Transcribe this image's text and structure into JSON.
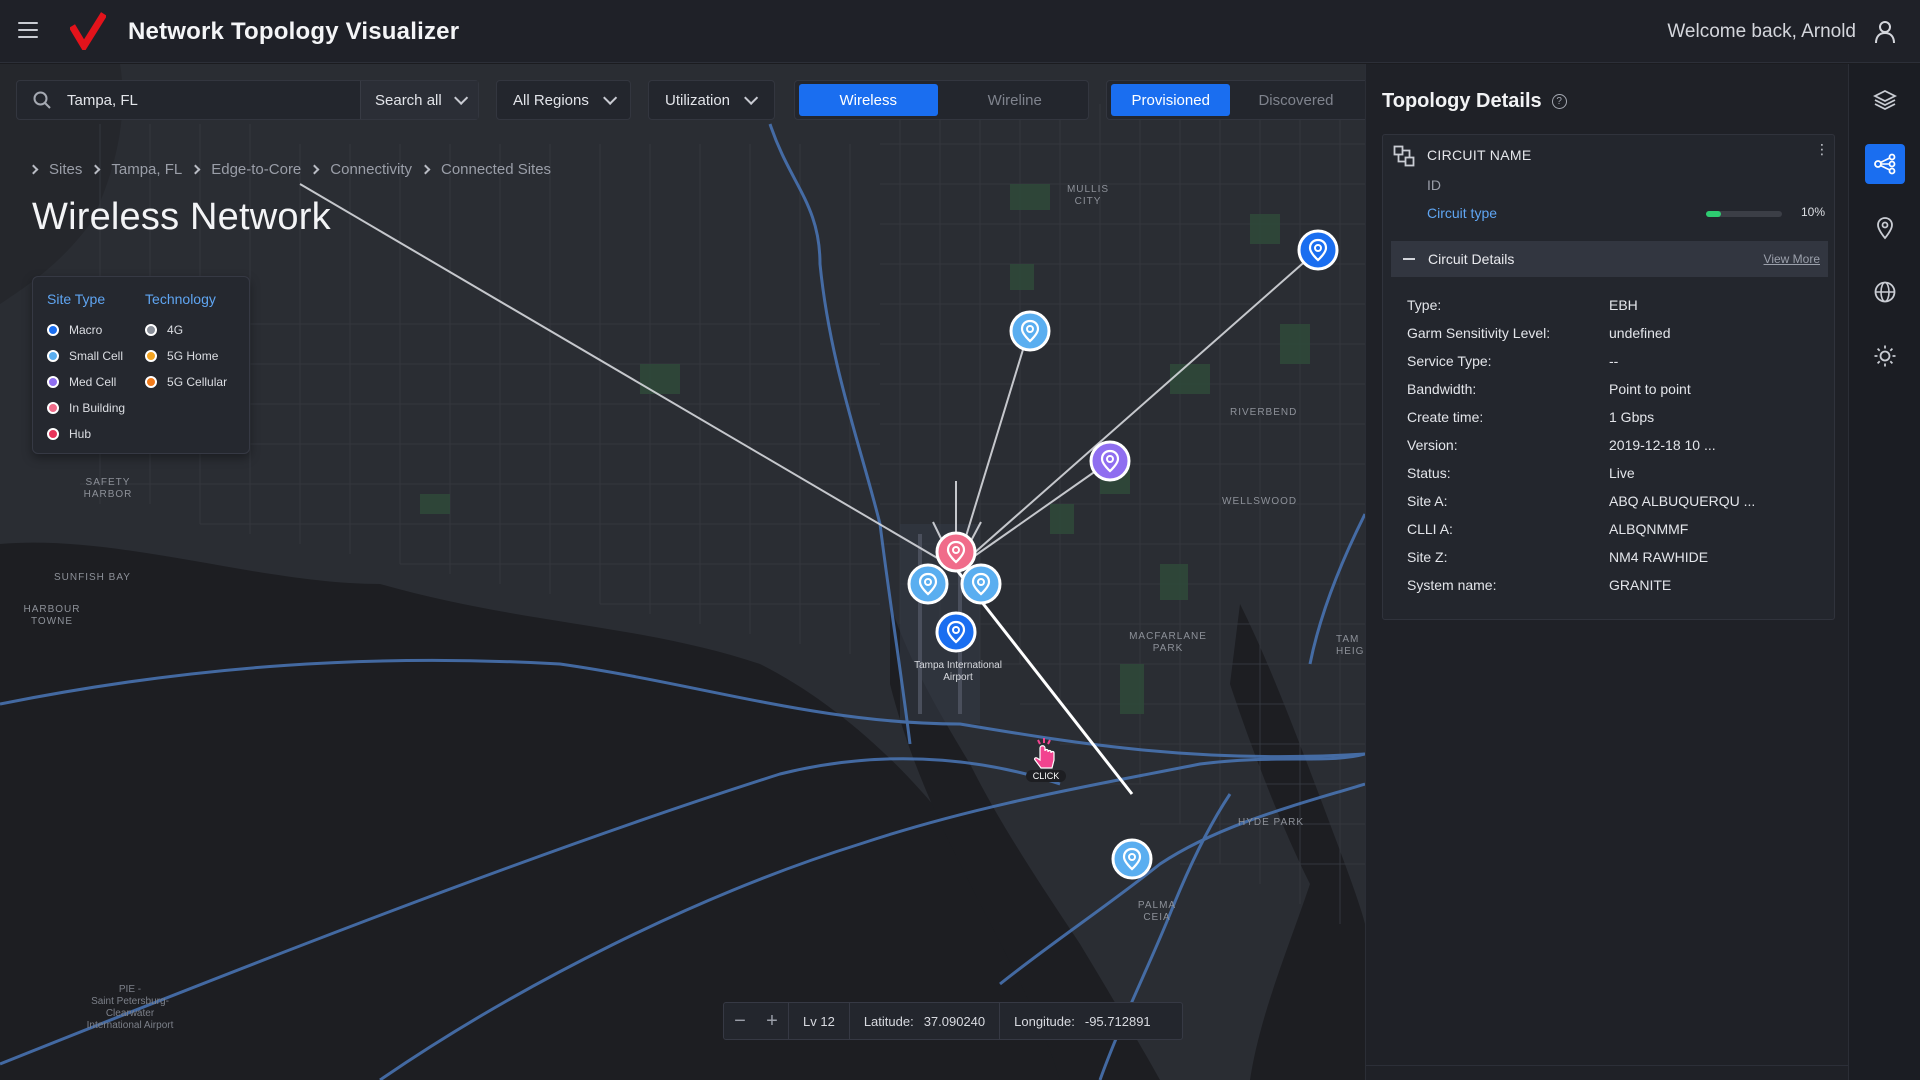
{
  "header": {
    "app_title": "Network Topology Visualizer",
    "welcome": "Welcome back, Arnold"
  },
  "search": {
    "value": "Tampa, FL",
    "scope": "Search all"
  },
  "filters": {
    "regions": "All Regions",
    "metric": "Utilization",
    "network_toggle": [
      "Wireless",
      "Wireline"
    ],
    "network_active": "Wireless",
    "status_toggle": [
      "Provisioned",
      "Discovered"
    ],
    "status_active": "Provisioned"
  },
  "breadcrumb": [
    "Sites",
    "Tampa, FL",
    "Edge-to-Core",
    "Connectivity",
    "Connected Sites"
  ],
  "page_title": "Wireless Network",
  "legend": {
    "site_type_title": "Site Type",
    "technology_title": "Technology",
    "site_types": [
      {
        "label": "Macro",
        "color": "#1a6ef0"
      },
      {
        "label": "Small Cell",
        "color": "#5aaef0"
      },
      {
        "label": "Med Cell",
        "color": "#8f6ef0"
      },
      {
        "label": "In Building",
        "color": "#f06c8a"
      },
      {
        "label": "Hub",
        "color": "#e8335a"
      }
    ],
    "technologies": [
      {
        "label": "4G",
        "color": "#8a8f99"
      },
      {
        "label": "5G Home",
        "color": "#f4a523"
      },
      {
        "label": "5G Cellular",
        "color": "#f07a1a"
      }
    ]
  },
  "map": {
    "pin_label": "Tampa International Airport",
    "click_label": "CLICK",
    "places": [
      "MULLIS CITY",
      "RIVERBEND",
      "WELLSWOOD",
      "SAFETY HARBOR",
      "SUNFISH BAY",
      "HARBOUR TOWNE",
      "MACFARLANE PARK",
      "HYDE PARK",
      "PALMA CEIA",
      "TAMPA HEIGHTS",
      "PIE - Saint Petersburg-Clearwater International Airport"
    ]
  },
  "zoombar": {
    "level": "Lv 12",
    "lat_label": "Latitude:",
    "lat": "37.090240",
    "lon_label": "Longitude:",
    "lon": "-95.712891"
  },
  "panel": {
    "title": "Topology Details",
    "circuit_name": "CIRCUIT NAME",
    "id": "ID",
    "circuit_type": "Circuit type",
    "progress_percent": 10,
    "progress_label": "10%",
    "details_title": "Circuit Details",
    "view_more": "View More",
    "details": [
      {
        "k": "Type:",
        "v": "EBH"
      },
      {
        "k": "Garm Sensitivity Level:",
        "v": "undefined"
      },
      {
        "k": "Service Type:",
        "v": "--"
      },
      {
        "k": "Bandwidth:",
        "v": "Point to point"
      },
      {
        "k": "Create time:",
        "v": "1 Gbps"
      },
      {
        "k": "Version:",
        "v": "2019-12-18 10 ..."
      },
      {
        "k": "Status:",
        "v": "Live"
      },
      {
        "k": "Site A:",
        "v": "ABQ ALBUQUERQU ..."
      },
      {
        "k": "CLLI A:",
        "v": "ALBQNMMF"
      },
      {
        "k": "Site Z:",
        "v": "NM4 RAWHIDE"
      },
      {
        "k": "System name:",
        "v": "GRANITE"
      }
    ]
  },
  "rail_icons": [
    "layers-icon",
    "topology-icon",
    "location-pin-icon",
    "globe-icon",
    "brightness-icon"
  ]
}
